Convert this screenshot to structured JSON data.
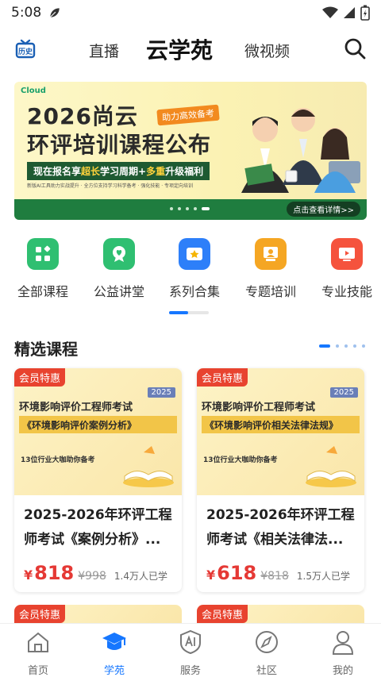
{
  "status_bar": {
    "time": "5:08"
  },
  "top_nav": {
    "history_label": "历史",
    "tabs": [
      {
        "label": "直播"
      },
      {
        "label": "云学苑"
      },
      {
        "label": "微视频"
      }
    ]
  },
  "banner": {
    "logo": "Cloud",
    "title_line1": "2026尚云",
    "title_line2": "环评培训课程公布",
    "tag": "助力高效备考",
    "stripe_prefix": "现在报名享",
    "stripe_hl1": "超长",
    "stripe_mid": "学习周期+",
    "stripe_hl2": "多重",
    "stripe_suffix": "升级福利",
    "fine_print": "新版AI工具助力实战提升 · 全方位支持学习科学备考 · 强化技能 · 专项定向培训",
    "cta": "点击查看详情>>",
    "slide_count": 5,
    "active_slide": 4
  },
  "categories": [
    {
      "label": "全部课程",
      "icon": "grid-icon",
      "color": "#2fbf71"
    },
    {
      "label": "公益讲堂",
      "icon": "heart-badge-icon",
      "color": "#2fbf71"
    },
    {
      "label": "系列合集",
      "icon": "star-box-icon",
      "color": "#2d7ff9"
    },
    {
      "label": "专题培训",
      "icon": "presenter-icon",
      "color": "#f5a623"
    },
    {
      "label": "专业技能",
      "icon": "play-screen-icon",
      "color": "#f5533d"
    }
  ],
  "featured": {
    "title": "精选课程",
    "page_count": 5,
    "active_page": 0,
    "courses": [
      {
        "vip_badge": "会员特惠",
        "cover_year": "2025",
        "cover_title": "环境影响评价工程师考试",
        "cover_subtitle": "《环境影响评价案例分析》",
        "cover_footer": "13位行业大咖助你备考",
        "name": "2025-2026年环评工程师考试《案例分析》...",
        "currency": "¥",
        "price": "818",
        "original_price": "¥998",
        "learners": "1.4万人已学"
      },
      {
        "vip_badge": "会员特惠",
        "cover_year": "2025",
        "cover_title": "环境影响评价工程师考试",
        "cover_subtitle": "《环境影响评价相关法律法规》",
        "cover_footer": "13位行业大咖助你备考",
        "name": "2025-2026年环评工程师考试《相关法律法...",
        "currency": "¥",
        "price": "618",
        "original_price": "¥818",
        "learners": "1.5万人已学"
      }
    ],
    "peek_badges": [
      "会员特惠",
      "会员特惠"
    ]
  },
  "bottom_nav": [
    {
      "label": "首页",
      "icon": "home-icon",
      "active": false
    },
    {
      "label": "学苑",
      "icon": "graduation-cap-icon",
      "active": true
    },
    {
      "label": "服务",
      "icon": "ai-shield-icon",
      "active": false
    },
    {
      "label": "社区",
      "icon": "compass-icon",
      "active": false
    },
    {
      "label": "我的",
      "icon": "person-icon",
      "active": false
    }
  ],
  "colors": {
    "accent": "#1677ff",
    "price": "#e53935",
    "vip": "#e8432f"
  }
}
